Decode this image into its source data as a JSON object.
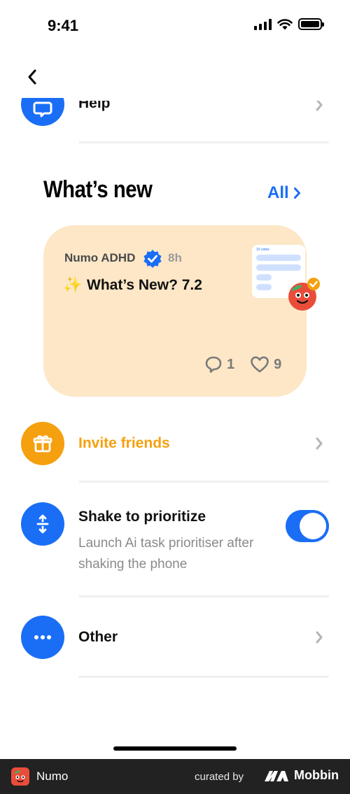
{
  "status_bar": {
    "time": "9:41"
  },
  "help": {
    "title": "Help"
  },
  "whats_new": {
    "title": "What’s new",
    "all_label": "All",
    "card": {
      "author": "Numo ADHD",
      "time": "8h",
      "emoji": "✨",
      "title": "What’s New? 7.2",
      "comments": "1",
      "likes": "9",
      "thumb_header": "10 votes"
    }
  },
  "invite": {
    "title": "Invite friends",
    "accent": "#f5a00f"
  },
  "shake": {
    "title": "Shake to prioritize",
    "description": "Launch Ai task prioritiser after shaking the phone",
    "toggle_on": true
  },
  "other": {
    "title": "Other"
  },
  "colors": {
    "primary": "#1a6ef5",
    "card_bg": "#fde7c7"
  },
  "footer": {
    "app_name": "Numo",
    "curated_by": "curated by",
    "brand": "Mobbin"
  }
}
